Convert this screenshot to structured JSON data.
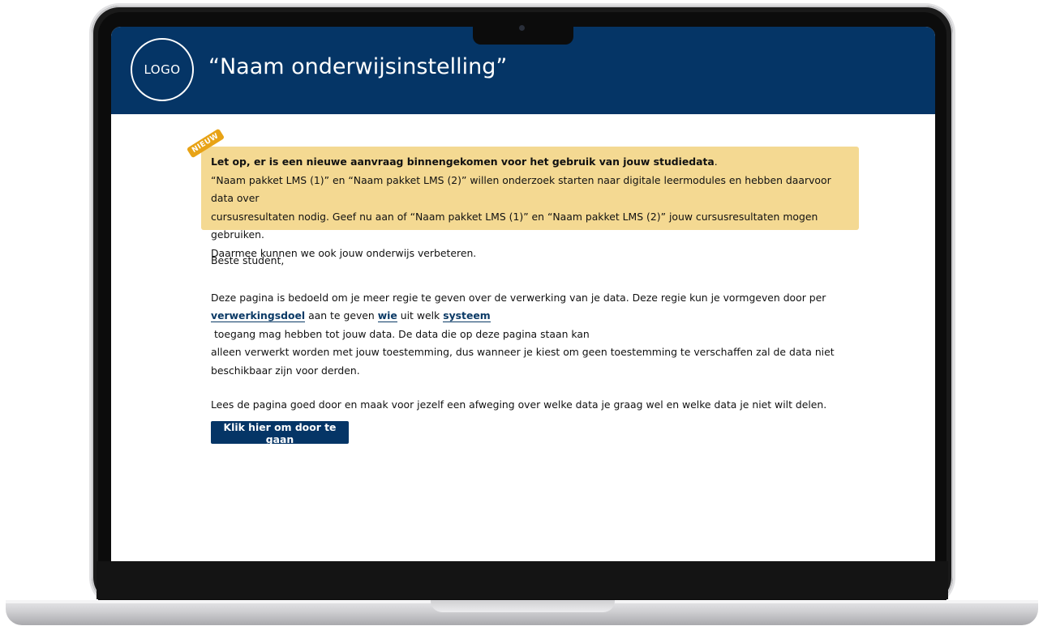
{
  "header": {
    "logo_text": "LOGO",
    "institution_name": "“Naam onderwijsinstelling”"
  },
  "notice": {
    "badge": "NIEUW",
    "lead": "Let op, er is een nieuwe aanvraag binnengekomen voor het gebruik van jouw studiedata",
    "lead_end": ".",
    "body_line1": "“Naam pakket LMS (1)” en “Naam pakket LMS (2)” willen onderzoek starten naar digitale leermodules en hebben daarvoor data over",
    "body_line2": "cursusresultaten nodig. Geef nu aan of “Naam pakket LMS (1)” en “Naam pakket LMS (2)” jouw cursusresultaten mogen gebruiken.",
    "body_line3": "Daarmee kunnen we ook jouw onderwijs verbeteren."
  },
  "content": {
    "greeting": "Beste student,",
    "para1_a": "Deze pagina is bedoeld om je meer regie te geven over de verwerking van je data. Deze regie kun je vormgeven door per",
    "link_purpose": "verwerkingsdoel",
    "para1_b": " aan te geven ",
    "link_who": "wie",
    "para1_c": " uit welk ",
    "link_system": "systeem",
    "para1_d": " toegang mag hebben tot jouw data. De data die op deze pagina staan kan",
    "para1_e": "alleen verwerkt worden met jouw toestemming, dus wanneer je kiest om geen toestemming te verschaffen zal de data niet",
    "para1_f": "beschikbaar zijn voor derden.",
    "para2": "Lees de pagina goed door en maak voor jezelf een afweging over welke data je graag wel en welke data je niet wilt delen.",
    "cta_label": "Klik hier om door te gaan"
  },
  "colors": {
    "brand": "#053566",
    "notice_bg": "#f4d992",
    "badge_bg": "#e8a316"
  }
}
